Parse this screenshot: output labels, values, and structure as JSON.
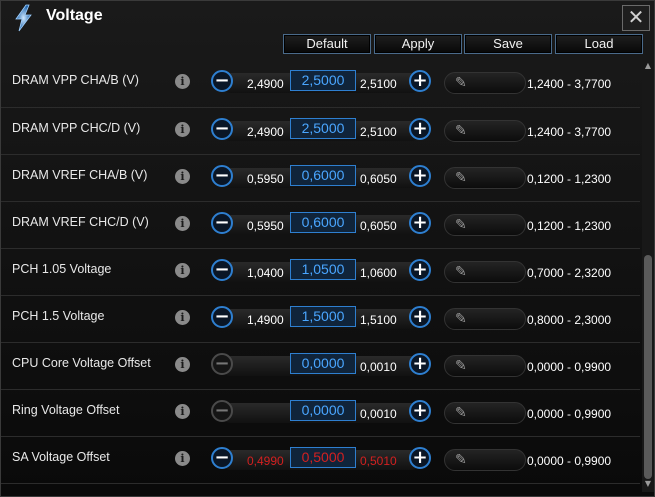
{
  "window": {
    "title": "Voltage",
    "close_label": "✕",
    "app_icon": "lightning-icon"
  },
  "toolbar": {
    "default_label": "Default",
    "apply_label": "Apply",
    "save_label": "Save",
    "load_label": "Load"
  },
  "rows": [
    {
      "label": "DRAM VPP CHA/B (V)",
      "lower": "2,4900",
      "current": "2,5000",
      "upper": "2,5100",
      "range": "1,2400 - 3,7700",
      "minus_enabled": true,
      "warning": false
    },
    {
      "label": "DRAM VPP CHC/D (V)",
      "lower": "2,4900",
      "current": "2,5000",
      "upper": "2,5100",
      "range": "1,2400 - 3,7700",
      "minus_enabled": true,
      "warning": false
    },
    {
      "label": "DRAM VREF CHA/B (V)",
      "lower": "0,5950",
      "current": "0,6000",
      "upper": "0,6050",
      "range": "0,1200 - 1,2300",
      "minus_enabled": true,
      "warning": false
    },
    {
      "label": "DRAM VREF CHC/D (V)",
      "lower": "0,5950",
      "current": "0,6000",
      "upper": "0,6050",
      "range": "0,1200 - 1,2300",
      "minus_enabled": true,
      "warning": false
    },
    {
      "label": "PCH 1.05 Voltage",
      "lower": "1,0400",
      "current": "1,0500",
      "upper": "1,0600",
      "range": "0,7000 - 2,3200",
      "minus_enabled": true,
      "warning": false
    },
    {
      "label": "PCH 1.5 Voltage",
      "lower": "1,4900",
      "current": "1,5000",
      "upper": "1,5100",
      "range": "0,8000 - 2,3000",
      "minus_enabled": true,
      "warning": false
    },
    {
      "label": "CPU Core Voltage Offset",
      "lower": "",
      "current": "0,0000",
      "upper": "0,0010",
      "range": "0,0000 - 0,9900",
      "minus_enabled": false,
      "warning": false
    },
    {
      "label": "Ring Voltage Offset",
      "lower": "",
      "current": "0,0000",
      "upper": "0,0010",
      "range": "0,0000 - 0,9900",
      "minus_enabled": false,
      "warning": false
    },
    {
      "label": "SA Voltage Offset",
      "lower": "0,4990",
      "current": "0,5000",
      "upper": "0,5010",
      "range": "0,0000 - 0,9900",
      "minus_enabled": true,
      "warning": true
    }
  ],
  "icons": {
    "info": "i",
    "minus": "−",
    "plus": "+",
    "pencil": "✎",
    "scroll_up": "▲",
    "scroll_down": "▼"
  },
  "colors": {
    "accent": "#2e7fd0",
    "value_text": "#4aa6ff",
    "warning": "#d32020"
  }
}
